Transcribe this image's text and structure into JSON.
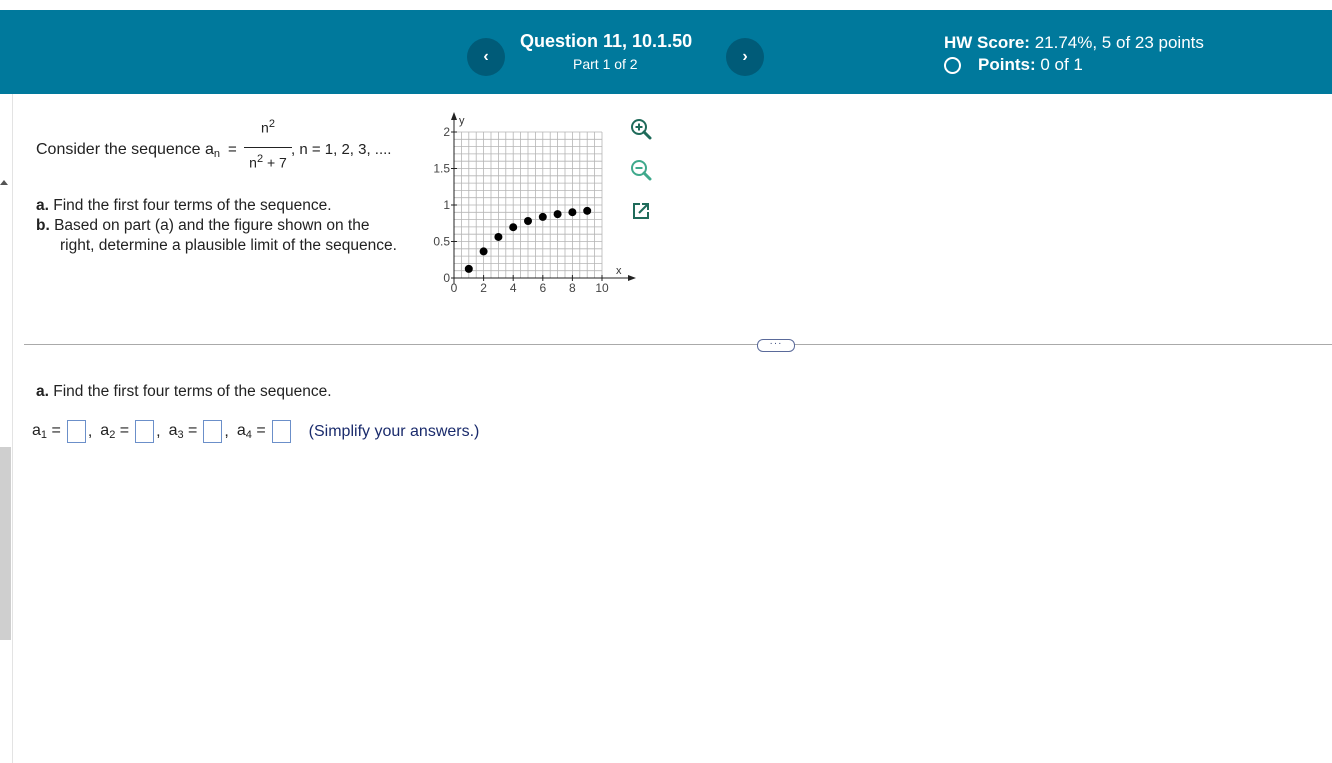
{
  "header": {
    "prev_icon": "‹",
    "next_icon": "›",
    "question_title": "Question 11, 10.1.50",
    "part": "Part 1 of 2",
    "hw_score_label": "HW Score:",
    "hw_score_value": "21.74%, 5 of 23 points",
    "points_label": "Points:",
    "points_value": "0 of 1",
    "color": "#00799c"
  },
  "problem": {
    "intro": "Consider the sequence a",
    "intro_sub": "n",
    "numerator": "n",
    "numerator_sup": "2",
    "denominator": "n",
    "denominator_sup": "2",
    "denominator_rest": " + 7",
    "range": ", n = 1, 2, 3, ....",
    "part_a_label": "a.",
    "part_a_text": "Find the first four terms of the sequence.",
    "part_b_label": "b.",
    "part_b_text_1": "Based on part (a) and the figure shown on the",
    "part_b_text_2": "right, determine a plausible limit of the sequence."
  },
  "chart_data": {
    "type": "scatter",
    "xlabel": "x",
    "ylabel": "y",
    "xlim": [
      0,
      10
    ],
    "ylim": [
      0,
      2
    ],
    "x_ticks": [
      "0",
      "2",
      "4",
      "6",
      "8",
      "10"
    ],
    "y_ticks": [
      "0",
      "0.5",
      "1",
      "1.5",
      "2"
    ],
    "grid": true,
    "points": [
      {
        "x": 1,
        "y": 0.125
      },
      {
        "x": 2,
        "y": 0.364
      },
      {
        "x": 3,
        "y": 0.5625
      },
      {
        "x": 4,
        "y": 0.696
      },
      {
        "x": 5,
        "y": 0.781
      },
      {
        "x": 6,
        "y": 0.837
      },
      {
        "x": 7,
        "y": 0.875
      },
      {
        "x": 8,
        "y": 0.901
      },
      {
        "x": 9,
        "y": 0.92
      }
    ]
  },
  "tools": {
    "zoom_in_icon": "zoom-in-icon",
    "zoom_out_icon": "zoom-out-icon",
    "popout_icon": "popout-icon"
  },
  "more_button": "···",
  "answer_section": {
    "label": "a.",
    "text": "Find the first four terms of the sequence.",
    "items": [
      {
        "name": "a",
        "sub": "1",
        "eq": "=",
        "value": ""
      },
      {
        "name": "a",
        "sub": "2",
        "eq": "=",
        "value": ""
      },
      {
        "name": "a",
        "sub": "3",
        "eq": "=",
        "value": ""
      },
      {
        "name": "a",
        "sub": "4",
        "eq": "=",
        "value": ""
      }
    ],
    "simplify_note": "(Simplify your answers.)"
  }
}
